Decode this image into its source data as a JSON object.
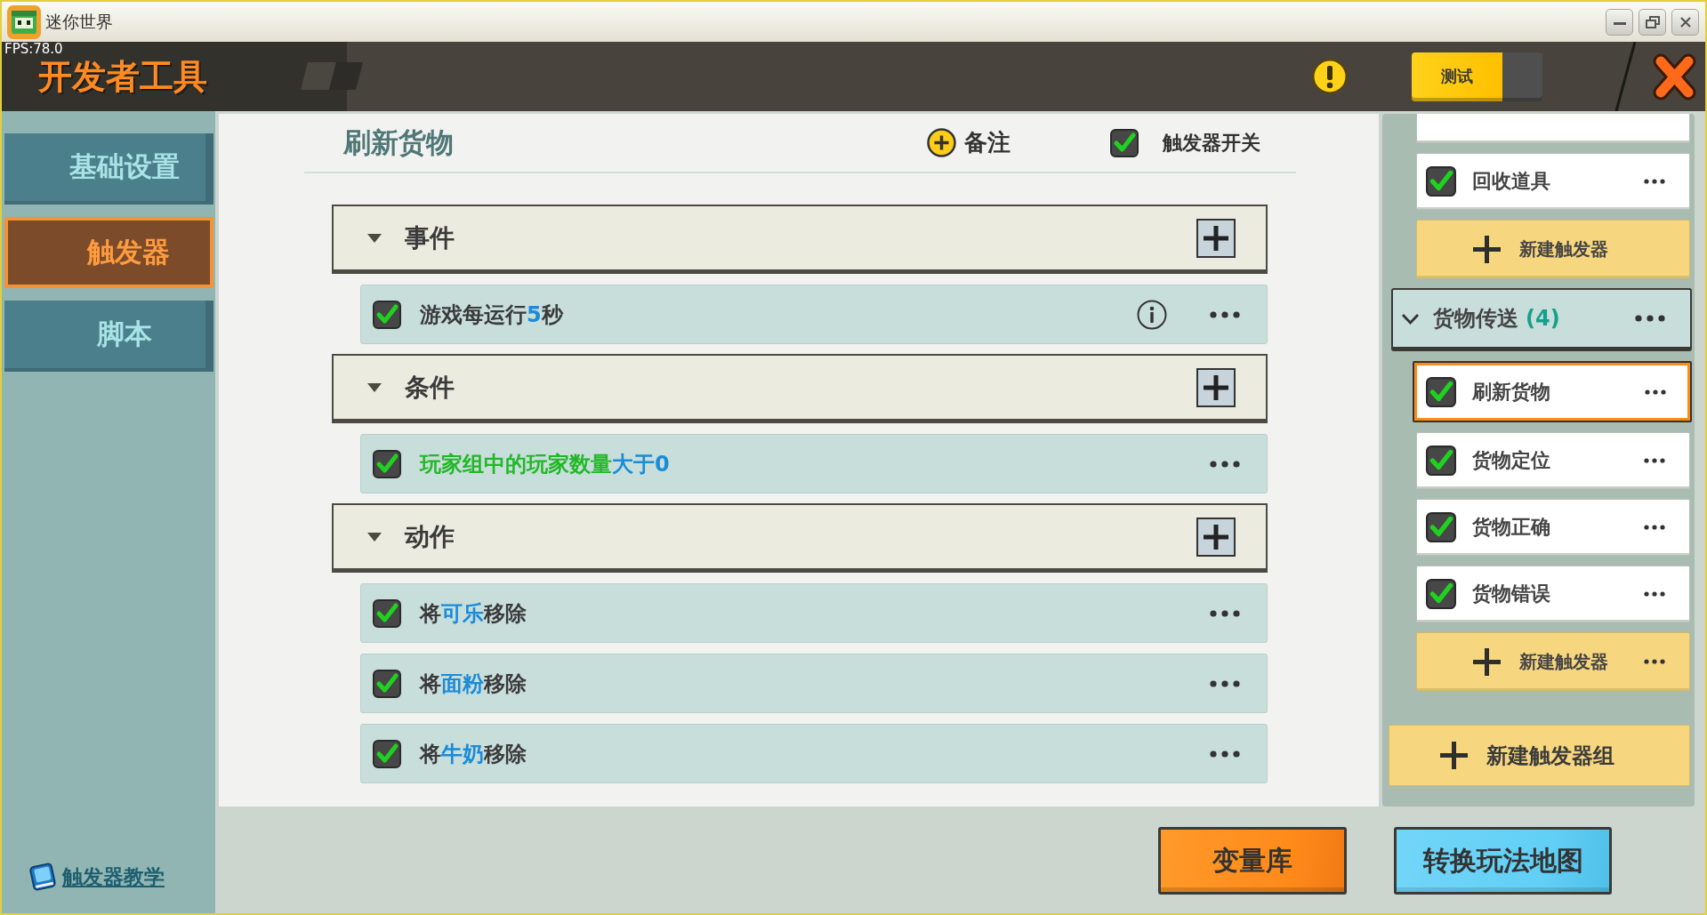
{
  "window": {
    "title": "迷你世界"
  },
  "header": {
    "fps": "FPS:78.0",
    "title": "开发者工具",
    "test_button": "测试"
  },
  "sidebar": {
    "tabs": [
      {
        "label": "基础设置",
        "selected": false
      },
      {
        "label": "触发器",
        "selected": true
      },
      {
        "label": "脚本",
        "selected": false
      }
    ],
    "tutorial_link": "触发器教学"
  },
  "editor": {
    "title": "刷新货物",
    "note_button": "备注",
    "trigger_switch": {
      "label": "触发器开关",
      "checked": true
    },
    "sections": [
      {
        "title": "事件",
        "expanded": true,
        "items": [
          {
            "checked": true,
            "has_info": true,
            "segments": [
              {
                "kind": "text",
                "text": "游戏每运行"
              },
              {
                "kind": "param",
                "text": "5"
              },
              {
                "kind": "text",
                "text": "秒"
              }
            ]
          }
        ]
      },
      {
        "title": "条件",
        "expanded": true,
        "items": [
          {
            "checked": true,
            "has_info": false,
            "segments": [
              {
                "kind": "subject",
                "text": "玩家组中的玩家数量"
              },
              {
                "kind": "param",
                "text": "大于0"
              }
            ]
          }
        ]
      },
      {
        "title": "动作",
        "expanded": true,
        "items": [
          {
            "checked": true,
            "has_info": false,
            "segments": [
              {
                "kind": "text",
                "text": "将"
              },
              {
                "kind": "param",
                "text": "可乐"
              },
              {
                "kind": "text",
                "text": "移除"
              }
            ]
          },
          {
            "checked": true,
            "has_info": false,
            "segments": [
              {
                "kind": "text",
                "text": "将"
              },
              {
                "kind": "param",
                "text": "面粉"
              },
              {
                "kind": "text",
                "text": "移除"
              }
            ]
          },
          {
            "checked": true,
            "has_info": false,
            "segments": [
              {
                "kind": "text",
                "text": "将"
              },
              {
                "kind": "param",
                "text": "牛奶"
              },
              {
                "kind": "text",
                "text": "移除"
              }
            ]
          }
        ]
      }
    ]
  },
  "trigger_list": {
    "entries": [
      {
        "kind": "cut_off"
      },
      {
        "kind": "trigger",
        "label": "回收道具",
        "checked": true,
        "selected": false
      },
      {
        "kind": "new_trigger",
        "label": "新建触发器",
        "menu": false
      },
      {
        "kind": "group",
        "label": "货物传送",
        "count": "(4)",
        "expanded": true
      },
      {
        "kind": "trigger",
        "label": "刷新货物",
        "checked": true,
        "selected": true
      },
      {
        "kind": "trigger",
        "label": "货物定位",
        "checked": true,
        "selected": false
      },
      {
        "kind": "trigger",
        "label": "货物正确",
        "checked": true,
        "selected": false
      },
      {
        "kind": "trigger",
        "label": "货物错误",
        "checked": true,
        "selected": false
      },
      {
        "kind": "new_trigger",
        "label": "新建触发器",
        "menu": true
      }
    ],
    "new_group_button": "新建触发器组"
  },
  "footer": {
    "buttons": [
      {
        "kind": "library",
        "label": "变量库"
      },
      {
        "kind": "convert",
        "label": "转换玩法地图"
      }
    ]
  }
}
